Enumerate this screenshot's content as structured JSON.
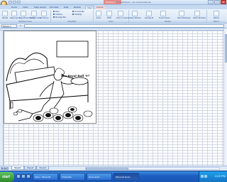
{
  "window": {
    "title": "Microsoft Excel - non-commercial use",
    "contextual_group": "Drawing Tools",
    "controls": [
      "minimize",
      "maximize",
      "close"
    ]
  },
  "ribbon": {
    "tabs": [
      "Home",
      "Insert",
      "Page Layout",
      "Formulas",
      "Data",
      "Review",
      "View",
      "Format"
    ],
    "active_tab": "Format",
    "groups": {
      "workbook_views": {
        "label": "Workbook Views",
        "buttons": [
          "Normal",
          "Page Layout",
          "Page Break Preview",
          "Custom Views",
          "Full Screen"
        ]
      },
      "show_hide": {
        "label": "Show/Hide",
        "checks": [
          "Ruler",
          "Gridlines",
          "Message Bar",
          "Formula Bar",
          "Headings"
        ]
      },
      "zoom": {
        "label": "Zoom",
        "buttons": [
          "Zoom",
          "100%",
          "Zoom to Selection"
        ]
      },
      "window": {
        "label": "Window",
        "buttons": [
          "New Window",
          "Arrange All",
          "Freeze Panes",
          "Save Workspace",
          "Switch Windows"
        ]
      },
      "macros": {
        "label": "Macros",
        "buttons": [
          "Macros"
        ]
      }
    }
  },
  "formula_bar": {
    "name_box": "Picture 1",
    "fx": "fx",
    "value": ""
  },
  "drawing": {
    "poster_text": "The Royal Ball '97"
  },
  "sheet_tabs": {
    "tabs": [
      "Sheet1",
      "Sheet2",
      "Sheet3"
    ],
    "active": "Sheet1"
  },
  "status": {
    "text": "Ready"
  },
  "taskbar": {
    "start_label": "start",
    "task_buttons": [
      "Inbox - Microsoft",
      "Cinderella",
      "Document1",
      "Microsoft Excel"
    ],
    "active_task": 3,
    "clock": "4:22 PM"
  }
}
